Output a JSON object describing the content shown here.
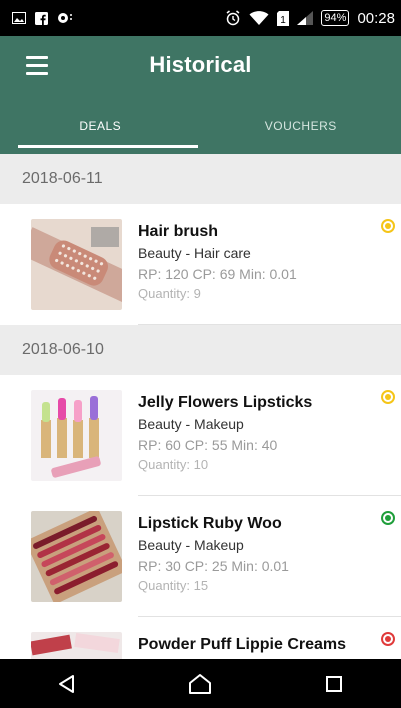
{
  "status_bar": {
    "time": "00:28",
    "battery": "94%",
    "sim": "1",
    "left_icons": [
      "image-notification-icon",
      "facebook-icon",
      "record-icon"
    ],
    "right_icons": [
      "alarm-icon",
      "wifi-icon",
      "sim-icon",
      "signal-icon",
      "battery-icon"
    ]
  },
  "app_bar": {
    "title": "Historical",
    "menu_icon": "menu-icon"
  },
  "tabs": [
    {
      "label": "DEALS",
      "active": true
    },
    {
      "label": "VOUCHERS",
      "active": false
    }
  ],
  "sections": [
    {
      "date": "2018-06-11",
      "items": [
        {
          "name": "Hair brush",
          "category": "Beauty - Hair care",
          "prices": "RP: 120 CP: 69 Min: 0.01",
          "quantity": "Quantity: 9",
          "status_color": "#f5c518",
          "image": "hair-brush-image"
        }
      ]
    },
    {
      "date": "2018-06-10",
      "items": [
        {
          "name": "Jelly Flowers Lipsticks",
          "category": "Beauty - Makeup",
          "prices": "RP: 60 CP: 55 Min: 40",
          "quantity": "Quantity: 10",
          "status_color": "#f5c518",
          "image": "jelly-lipsticks-image"
        },
        {
          "name": "Lipstick Ruby Woo",
          "category": "Beauty - Makeup",
          "prices": "RP: 30 CP: 25 Min: 0.01",
          "quantity": "Quantity: 15",
          "status_color": "#1f9e3a",
          "image": "lipstick-palette-image"
        },
        {
          "name": "Powder Puff Lippie Creams",
          "category": "",
          "prices": "",
          "quantity": "",
          "status_color": "#e03a3a",
          "image": "lippie-creams-image"
        }
      ]
    }
  ],
  "nav_bar": {
    "buttons": [
      "back-icon",
      "home-icon",
      "recents-icon"
    ]
  },
  "colors": {
    "primary": "#3f7564",
    "status_bar": "#000000",
    "section_bg": "#ececec"
  }
}
